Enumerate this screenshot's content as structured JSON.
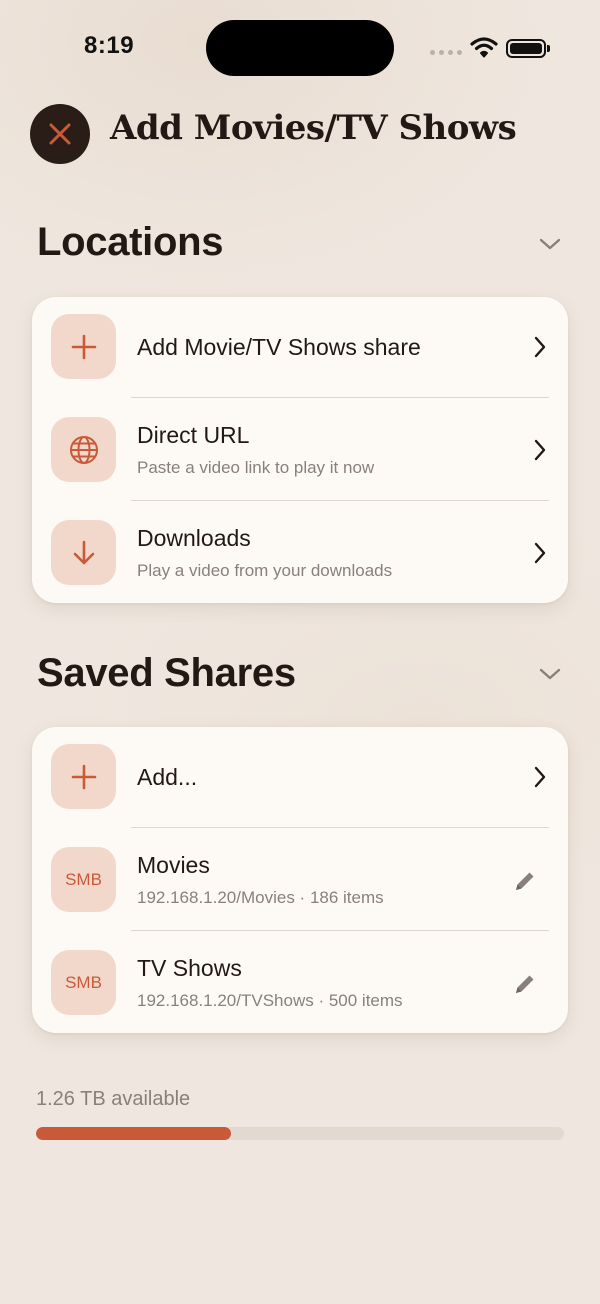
{
  "status_bar": {
    "time": "8:19"
  },
  "header": {
    "title": "Add Movies/TV Shows",
    "close_icon": "close-icon"
  },
  "locations": {
    "title": "Locations",
    "items": [
      {
        "icon": "plus-icon",
        "label": "Add Movie/TV Shows share",
        "subtitle": ""
      },
      {
        "icon": "globe-icon",
        "label": "Direct URL",
        "subtitle": "Paste a video link to play it now"
      },
      {
        "icon": "arrow-down-icon",
        "label": "Downloads",
        "subtitle": "Play a video from your downloads"
      }
    ]
  },
  "saved_shares": {
    "title": "Saved Shares",
    "add_label": "Add...",
    "items": [
      {
        "badge": "SMB",
        "label": "Movies",
        "subtitle": "192.168.1.20/Movies · 186 items"
      },
      {
        "badge": "SMB",
        "label": "TV Shows",
        "subtitle": "192.168.1.20/TVShows · 500 items"
      }
    ]
  },
  "storage": {
    "label": "1.26 TB available",
    "used_fraction": 0.37
  },
  "colors": {
    "accent": "#c85a3a",
    "icon_bg": "#f2d8cb",
    "background": "#efe7df",
    "card": "#fdfaf6",
    "text": "#231814",
    "secondary_text": "#8a807a"
  }
}
